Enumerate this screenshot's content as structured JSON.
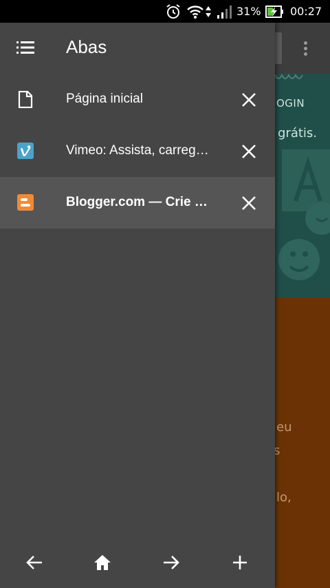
{
  "status_bar": {
    "battery_percent": "31%",
    "time": "00:27",
    "icons": [
      "alarm-icon",
      "wifi-icon",
      "data-arrows-icon",
      "signal-icon",
      "battery-charging-icon"
    ]
  },
  "background_page": {
    "login_text": "OGIN",
    "gratis_text": "grátis.",
    "text_1": "eu",
    "text_2": "s",
    "text_3": "lo,"
  },
  "drawer": {
    "title": "Abas",
    "tabs": [
      {
        "label": "Página inicial",
        "favicon": "page-icon",
        "active": false
      },
      {
        "label": "Vimeo: Assista, carregue e compartilhe vídeos",
        "favicon": "vimeo-icon",
        "active": false
      },
      {
        "label": "Blogger.com — Crie um blog grátis",
        "favicon": "blogger-icon",
        "active": true
      }
    ],
    "bottom_bar": [
      "back-arrow-icon",
      "home-icon",
      "forward-arrow-icon",
      "add-icon"
    ]
  },
  "colors": {
    "drawer_bg": "#454545",
    "active_tab_bg": "#555555",
    "vimeo": "#4aa3c9",
    "blogger": "#f28a35"
  }
}
